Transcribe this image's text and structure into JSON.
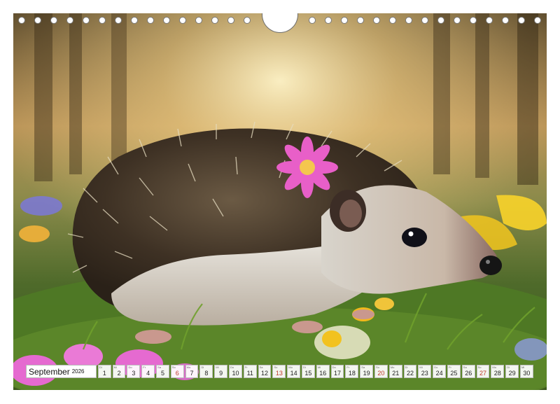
{
  "calendar": {
    "month": "September",
    "year": "2026",
    "days": [
      {
        "num": "1",
        "dow": "Di",
        "weekend": false
      },
      {
        "num": "2",
        "dow": "Mi",
        "weekend": false
      },
      {
        "num": "3",
        "dow": "Do",
        "weekend": false
      },
      {
        "num": "4",
        "dow": "Fr",
        "weekend": false
      },
      {
        "num": "5",
        "dow": "Sa",
        "weekend": false
      },
      {
        "num": "6",
        "dow": "So",
        "weekend": true
      },
      {
        "num": "7",
        "dow": "Mo",
        "weekend": false
      },
      {
        "num": "8",
        "dow": "Di",
        "weekend": false
      },
      {
        "num": "9",
        "dow": "Mi",
        "weekend": false
      },
      {
        "num": "10",
        "dow": "Do",
        "weekend": false
      },
      {
        "num": "11",
        "dow": "Fr",
        "weekend": false
      },
      {
        "num": "12",
        "dow": "Sa",
        "weekend": false
      },
      {
        "num": "13",
        "dow": "So",
        "weekend": true
      },
      {
        "num": "14",
        "dow": "Mo",
        "weekend": false
      },
      {
        "num": "15",
        "dow": "Di",
        "weekend": false
      },
      {
        "num": "16",
        "dow": "Mi",
        "weekend": false
      },
      {
        "num": "17",
        "dow": "Do",
        "weekend": false
      },
      {
        "num": "18",
        "dow": "Fr",
        "weekend": false
      },
      {
        "num": "19",
        "dow": "Sa",
        "weekend": false
      },
      {
        "num": "20",
        "dow": "So",
        "weekend": true
      },
      {
        "num": "21",
        "dow": "Mo",
        "weekend": false
      },
      {
        "num": "22",
        "dow": "Di",
        "weekend": false
      },
      {
        "num": "23",
        "dow": "Mi",
        "weekend": false
      },
      {
        "num": "24",
        "dow": "Do",
        "weekend": false
      },
      {
        "num": "25",
        "dow": "Fr",
        "weekend": false
      },
      {
        "num": "26",
        "dow": "Sa",
        "weekend": false
      },
      {
        "num": "27",
        "dow": "So",
        "weekend": true
      },
      {
        "num": "28",
        "dow": "Mo",
        "weekend": false
      },
      {
        "num": "29",
        "dow": "Di",
        "weekend": false
      },
      {
        "num": "30",
        "dow": "Mi",
        "weekend": false
      }
    ]
  },
  "colors": {
    "weekend": "#c0392b",
    "hole_ring": "#7a7a7a"
  }
}
